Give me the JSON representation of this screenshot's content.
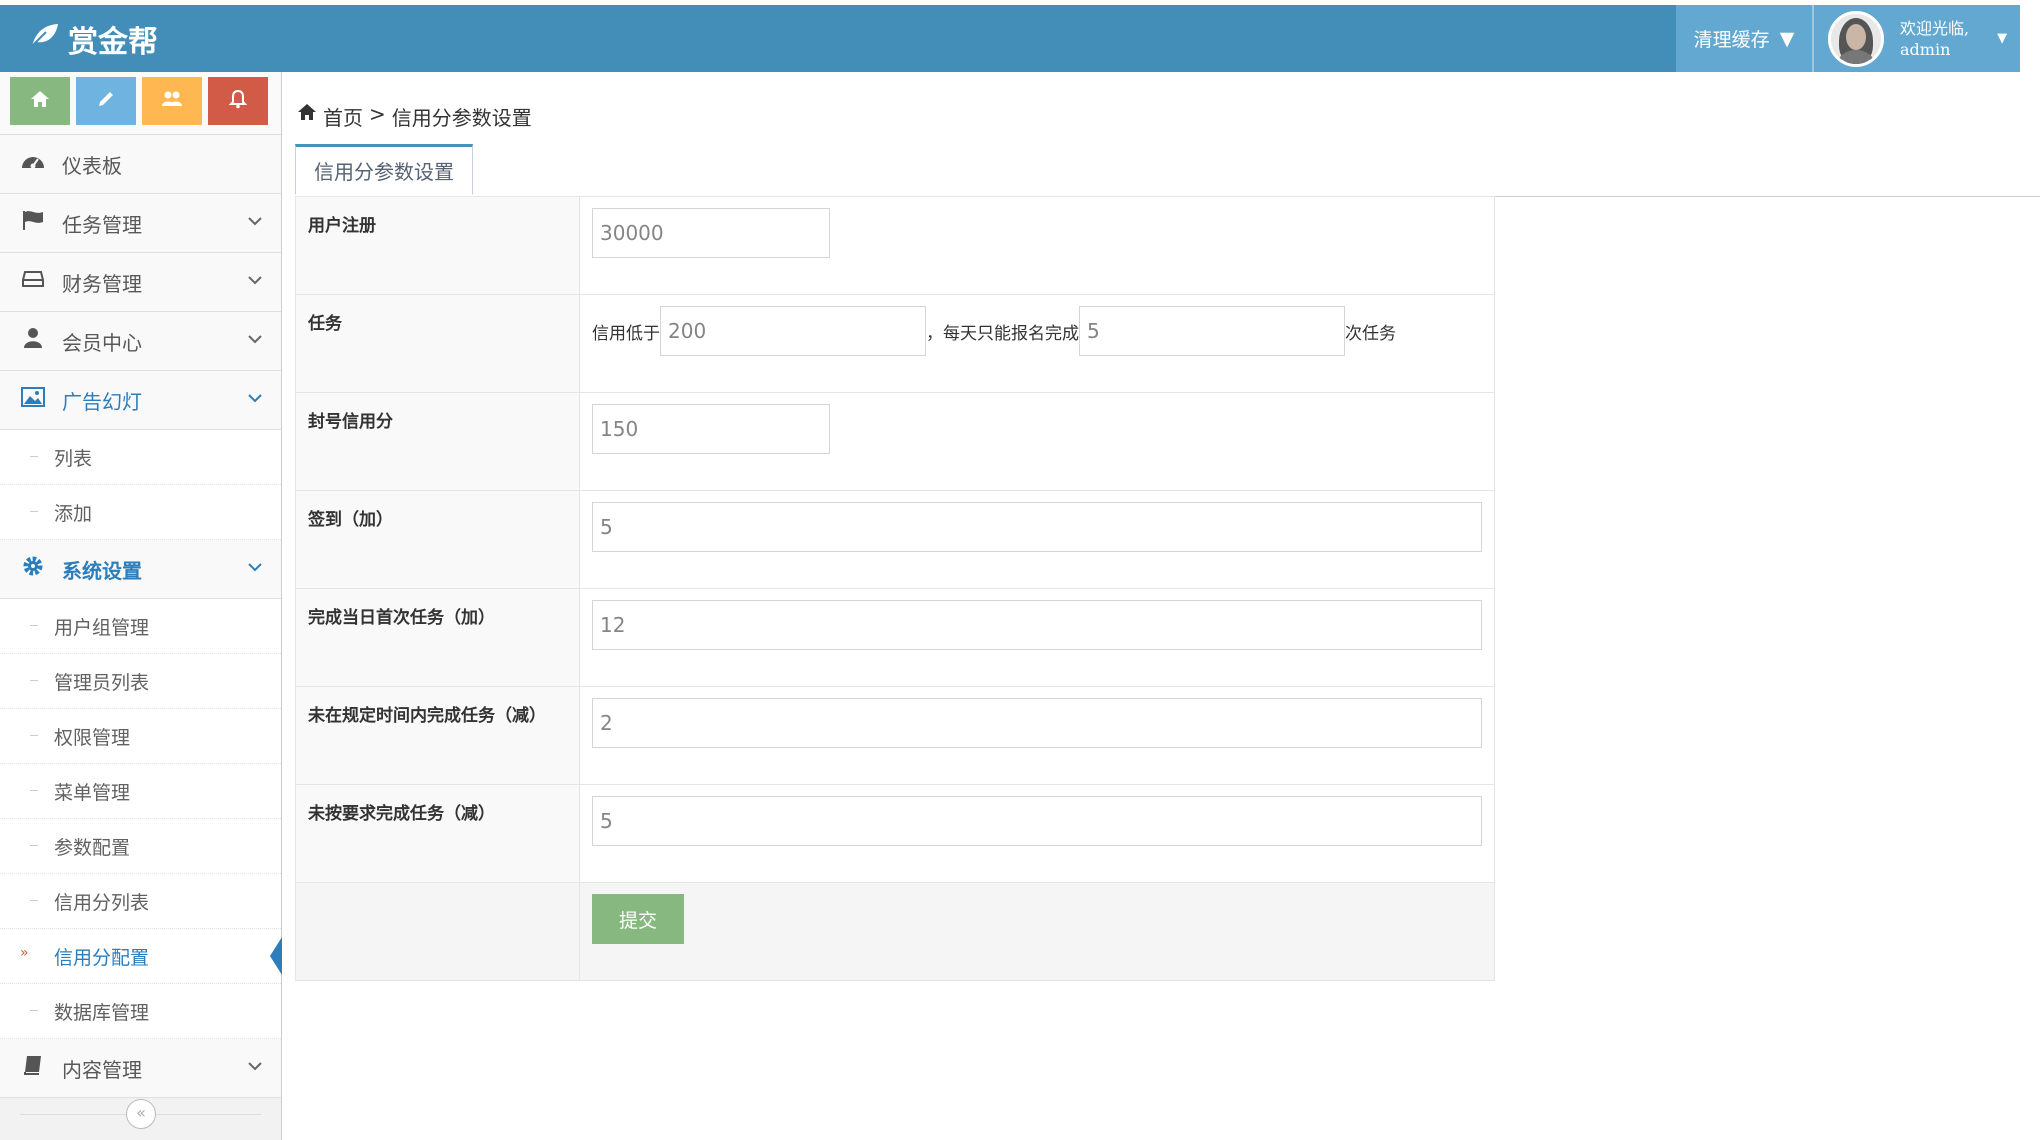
{
  "brand": {
    "name": "赏金帮"
  },
  "header": {
    "clear_cache": "清理缓存",
    "welcome": "欢迎光临,",
    "username": "admin"
  },
  "shortcuts": [
    {
      "icon": "home-icon",
      "color": "#87b87f"
    },
    {
      "icon": "pencil-icon",
      "color": "#6fb3e0"
    },
    {
      "icon": "users-icon",
      "color": "#ffb752"
    },
    {
      "icon": "bell-icon",
      "color": "#d15b47"
    }
  ],
  "sidebar": {
    "dashboard": "仪表板",
    "task_mgmt": "任务管理",
    "finance_mgmt": "财务管理",
    "member_center": "会员中心",
    "ad_slides": "广告幻灯",
    "ad_sub": [
      "列表",
      "添加"
    ],
    "system_settings": "系统设置",
    "system_sub": [
      "用户组管理",
      "管理员列表",
      "权限管理",
      "菜单管理",
      "参数配置",
      "信用分列表",
      "信用分配置",
      "数据库管理"
    ],
    "content_mgmt": "内容管理"
  },
  "breadcrumb": {
    "home": "首页",
    "sep": ">",
    "current": "信用分参数设置"
  },
  "tab": {
    "label": "信用分参数设置"
  },
  "form": {
    "register": {
      "label": "用户注册",
      "value": "30000"
    },
    "task": {
      "label": "任务",
      "prefix": "信用低于",
      "credit": "200",
      "middle": "，每天只能报名完成",
      "count": "5",
      "suffix": "次任务"
    },
    "ban": {
      "label": "封号信用分",
      "value": "150"
    },
    "checkin": {
      "label": "签到（加）",
      "value": "5"
    },
    "first_task": {
      "label": "完成当日首次任务（加）",
      "value": "12"
    },
    "overdue": {
      "label": "未在规定时间内完成任务（减）",
      "value": "2"
    },
    "noncompliant": {
      "label": "未按要求完成任务（减）",
      "value": "5"
    },
    "submit": "提交"
  }
}
